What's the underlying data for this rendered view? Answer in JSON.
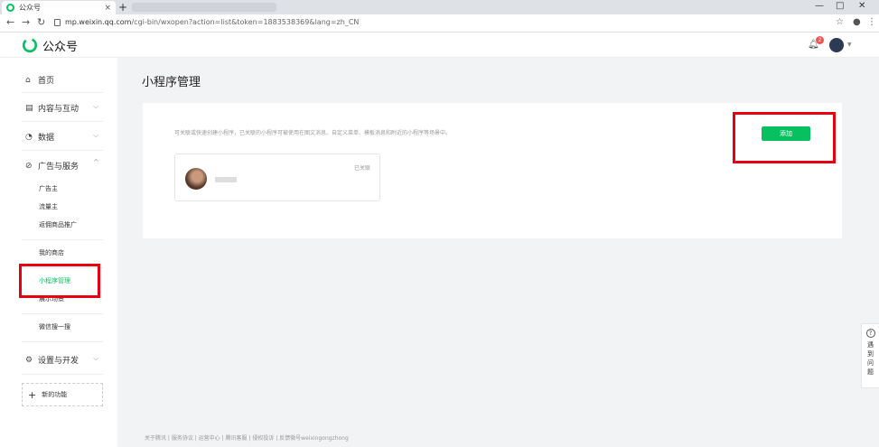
{
  "browser": {
    "tab_title": "公众号",
    "tab_close": "×",
    "new_tab": "+",
    "url_host": "mp.weixin.qq.com",
    "url_path": "/cgi-bin/wxopen?action=list&token=1883538369&lang=zh_CN",
    "window_controls": [
      "—",
      "□",
      "✕"
    ]
  },
  "header": {
    "logo_text": "公众号",
    "notification_count": "2"
  },
  "sidebar": {
    "home": "首页",
    "content": "内容与互动",
    "data": "数据",
    "ads": "广告与服务",
    "ads_sub": [
      "广告主",
      "流量主",
      "返佣商品推广"
    ],
    "my_store": "我的商店",
    "mini_program": "小程序管理",
    "display": "展示场景",
    "search": "微信搜一搜",
    "settings": "设置与开发",
    "new_func": "新的功能"
  },
  "main": {
    "title": "小程序管理",
    "description": "可关联或快速创建小程序，已关联的小程序可被使用在图文消息、自定义菜单、模板消息和附近的小程序等场景中。",
    "add_button": "添加",
    "linked_status": "已关联"
  },
  "help": {
    "icon": "?",
    "label": "遇到问题"
  },
  "footer": "关于腾讯 | 服务协议 | 运营中心 | 腾讯客服 | 侵权投诉 | 反馈微号weixingongzhong",
  "colors": {
    "accent_green": "#07c160",
    "highlight_red": "#e60012"
  }
}
